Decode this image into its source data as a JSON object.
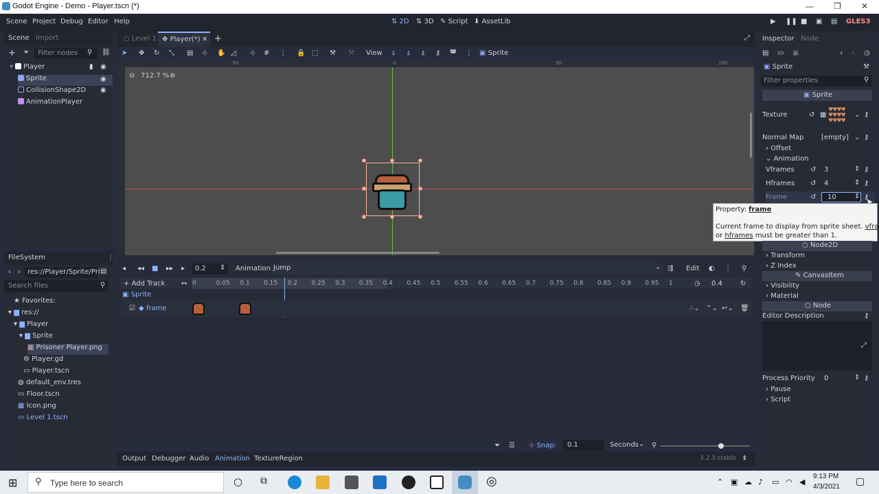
{
  "window": {
    "title": "Godot Engine - Demo - Player.tscn (*)"
  },
  "menu": {
    "items": [
      "Scene",
      "Project",
      "Debug",
      "Editor",
      "Help"
    ],
    "workspaces": [
      "2D",
      "3D",
      "Script",
      "AssetLib"
    ],
    "renderer": "GLES3"
  },
  "scene_panel": {
    "tabs": [
      "Scene",
      "Import"
    ],
    "filter_placeholder": "Filter nodes",
    "nodes": [
      {
        "label": "Player",
        "color": "#ffffff"
      },
      {
        "label": "Sprite",
        "color": "#8da5f3"
      },
      {
        "label": "CollisionShape2D",
        "color": "#8da5f3"
      },
      {
        "label": "AnimationPlayer",
        "color": "#c38ef1"
      }
    ]
  },
  "filesystem": {
    "title": "FileSystem",
    "path": "res://Player/Sprite/Pri",
    "search_placeholder": "Search files",
    "items": [
      "Favorites:",
      "res://",
      "Player",
      "Sprite",
      "Prisoner Player.png",
      "Player.gd",
      "Player.tscn",
      "default_env.tres",
      "Floor.tscn",
      "Icon.png",
      "Level 1.tscn"
    ]
  },
  "editor_tabs": {
    "tab1": "Level 1",
    "tab2": "Player(*)"
  },
  "viewport": {
    "zoom": "712.7 %",
    "view_label": "View",
    "sprite_label": "Sprite",
    "ruler": [
      "-50",
      "0",
      "50",
      "100"
    ]
  },
  "animation": {
    "step": "0.2",
    "label": "Animation",
    "current": "Jump",
    "edit": "Edit",
    "add_track": "Add Track",
    "ticks": [
      "0",
      "0.05",
      "0.1",
      "0.15",
      "0.2",
      "0.25",
      "0.3",
      "0.35",
      "0.4",
      "0.45",
      "0.5",
      "0.55",
      "0.6",
      "0.65",
      "0.7",
      "0.75",
      "0.8",
      "0.85",
      "0.9",
      "0.95",
      "1"
    ],
    "length": "0.4",
    "track_group": "Sprite",
    "track_name": "frame",
    "snap_label": "Snap:",
    "snap": "0.1",
    "unit": "Seconds"
  },
  "bottom_tabs": [
    "Output",
    "Debugger",
    "Audio",
    "Animation",
    "TextureRegion"
  ],
  "version": "3.2.3.stable",
  "inspector": {
    "tabs": [
      "Inspector",
      "Node"
    ],
    "object": "Sprite",
    "filter_placeholder": "Filter properties",
    "class_header": "Sprite",
    "texture_label": "Texture",
    "normal_map_label": "Normal Map",
    "normal_map_value": "[empty]",
    "offset": "Offset",
    "animation": "Animation",
    "vframes_label": "Vframes",
    "vframes": "3",
    "hframes_label": "Hframes",
    "hframes": "4",
    "frame_label": "Frame",
    "frame": "10",
    "tooltip_prefix": "Property:",
    "tooltip_prop": "frame",
    "tooltip_desc1": "Current frame to display from sprite sheet.",
    "tooltip_vf": "vframes",
    "tooltip_or": "or",
    "tooltip_hf": "hframes",
    "tooltip_desc2": "must be greater than 1.",
    "node2d": "Node2D",
    "transform": "Transform",
    "z_index": "Z Index",
    "canvas_item": "CanvasItem",
    "visibility": "Visibility",
    "material": "Material",
    "node": "Node",
    "editor_description": "Editor Description",
    "process_priority_label": "Process Priority",
    "process_priority": "0",
    "pause": "Pause",
    "script": "Script"
  },
  "taskbar": {
    "search_placeholder": "Type here to search",
    "time": "9:13 PM",
    "date": "4/3/2021"
  }
}
